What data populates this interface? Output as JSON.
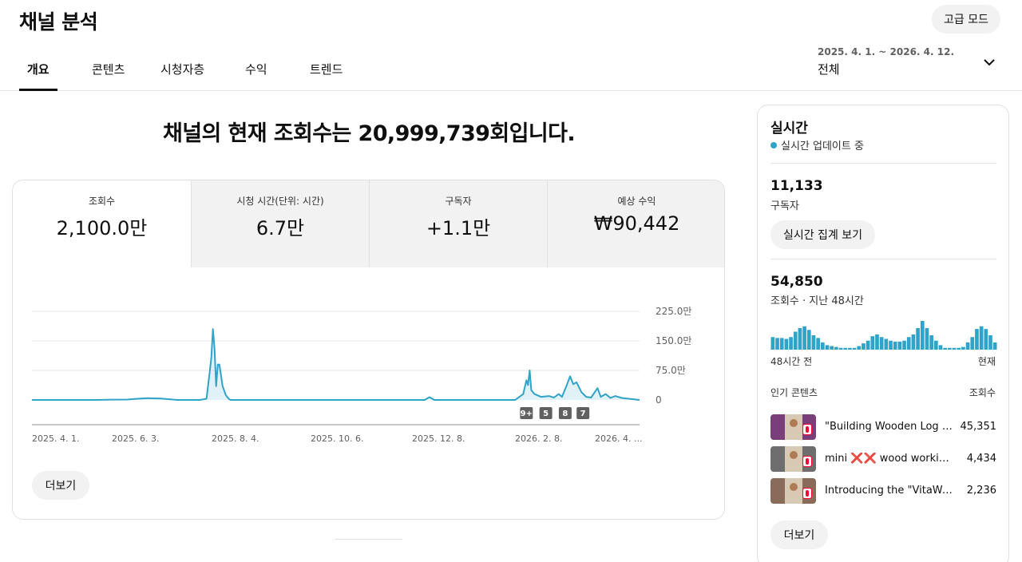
{
  "header": {
    "title": "채널 분석",
    "advanced_mode": "고급 모드"
  },
  "tabs": [
    "개요",
    "콘텐츠",
    "시청자층",
    "수익",
    "트렌드"
  ],
  "date_range": {
    "dates": "2025. 4. 1. ~ 2026. 4. 12.",
    "value": "전체",
    "icon": "chevron-down-icon"
  },
  "headline": "채널의 현재 조회수는 20,999,739회입니다.",
  "metrics": [
    {
      "label": "조회수",
      "value": "2,100.0만"
    },
    {
      "label": "시청 시간(단위: 시간)",
      "value": "6.7만"
    },
    {
      "label": "구독자",
      "value": "+1.1만"
    },
    {
      "label": "예상 수익",
      "value": "₩90,442"
    }
  ],
  "chart_data": {
    "type": "area",
    "series": [
      {
        "name": "조회수",
        "color": "#30a3c9"
      }
    ],
    "y_ticks": [
      "225.0만",
      "150.0만",
      "75.0만",
      "0"
    ],
    "x_ticks": [
      "2025. 4. 1.",
      "2025. 6. 3.",
      "2025. 8. 4.",
      "2025. 10. 6.",
      "2025. 12. 8.",
      "2026. 2. 8.",
      "2026. 4. ..."
    ],
    "ylim": [
      0,
      2250000
    ],
    "points": [
      [
        "2025-04-01",
        0
      ],
      [
        "2025-05-10",
        0
      ],
      [
        "2025-05-20",
        8000
      ],
      [
        "2025-05-30",
        10000
      ],
      [
        "2025-06-05",
        30000
      ],
      [
        "2025-06-12",
        45000
      ],
      [
        "2025-06-20",
        35000
      ],
      [
        "2025-06-30",
        0
      ],
      [
        "2025-07-14",
        0
      ],
      [
        "2025-07-18",
        30000
      ],
      [
        "2025-07-20",
        700000
      ],
      [
        "2025-07-21",
        1080000
      ],
      [
        "2025-07-22",
        1800000
      ],
      [
        "2025-07-23",
        1300000
      ],
      [
        "2025-07-24",
        350000
      ],
      [
        "2025-07-25",
        900000
      ],
      [
        "2025-07-26",
        900000
      ],
      [
        "2025-07-28",
        350000
      ],
      [
        "2025-07-30",
        120000
      ],
      [
        "2025-08-01",
        20000
      ],
      [
        "2025-08-02",
        0
      ],
      [
        "2025-11-30",
        0
      ],
      [
        "2025-12-03",
        70000
      ],
      [
        "2025-12-06",
        0
      ],
      [
        "2026-01-25",
        0
      ],
      [
        "2026-01-30",
        150000
      ],
      [
        "2026-02-01",
        500000
      ],
      [
        "2026-02-02",
        380000
      ],
      [
        "2026-02-03",
        750000
      ],
      [
        "2026-02-04",
        250000
      ],
      [
        "2026-02-06",
        150000
      ],
      [
        "2026-02-10",
        80000
      ],
      [
        "2026-02-15",
        100000
      ],
      [
        "2026-02-18",
        60000
      ],
      [
        "2026-02-21",
        150000
      ],
      [
        "2026-02-23",
        80000
      ],
      [
        "2026-02-26",
        380000
      ],
      [
        "2026-02-28",
        600000
      ],
      [
        "2026-03-02",
        400000
      ],
      [
        "2026-03-04",
        450000
      ],
      [
        "2026-03-07",
        200000
      ],
      [
        "2026-03-10",
        80000
      ],
      [
        "2026-03-13",
        60000
      ],
      [
        "2026-03-17",
        300000
      ],
      [
        "2026-03-19",
        80000
      ],
      [
        "2026-03-22",
        150000
      ],
      [
        "2026-03-25",
        50000
      ],
      [
        "2026-03-28",
        100000
      ],
      [
        "2026-04-01",
        50000
      ],
      [
        "2026-04-12",
        0
      ]
    ],
    "markers": [
      {
        "label": "9+",
        "date": "2026-02-01"
      },
      {
        "label": "5",
        "date": "2026-02-13"
      },
      {
        "label": "8",
        "date": "2026-02-25"
      },
      {
        "label": "7",
        "date": "2026-03-08"
      }
    ]
  },
  "more_label": "더보기",
  "realtime": {
    "title": "실시간",
    "status": "실시간 업데이트 중",
    "status_color": "#30a3c9",
    "subscribers": "11,133",
    "subscribers_label": "구독자",
    "button": "실시간 집계 보기",
    "views": "54,850",
    "views_label": "조회수 · 지난 48시간",
    "hourly_views": [
      14,
      13,
      13,
      12,
      14,
      20,
      24,
      26,
      22,
      16,
      13,
      8,
      5,
      4,
      3,
      2,
      2,
      2,
      2,
      4,
      7,
      10,
      15,
      17,
      14,
      12,
      10,
      9,
      9,
      10,
      14,
      17,
      24,
      32,
      24,
      16,
      10,
      5,
      2,
      2,
      2,
      2,
      3,
      8,
      14,
      23,
      26,
      23,
      16,
      8
    ],
    "axis_left": "48시간 전",
    "axis_right": "현재",
    "list_header": "인기 콘텐츠",
    "list_header_right": "조회수",
    "items": [
      {
        "title": "\"Building Wooden Log C...",
        "views": "45,351",
        "thumb_color": "#7a3f7a"
      },
      {
        "title": "mini ❌❌ wood working...",
        "views": "4,434",
        "thumb_color": "#6e6e6e"
      },
      {
        "title": "Introducing the \"VitaWear...",
        "views": "2,236",
        "thumb_color": "#8a6a58"
      }
    ],
    "more": "더보기"
  }
}
